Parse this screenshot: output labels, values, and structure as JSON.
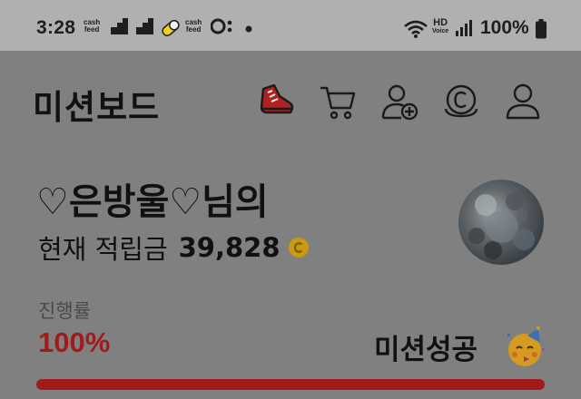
{
  "status_bar": {
    "time": "3:28",
    "notification_labels": [
      "cash\nfeed",
      "cash\nfeed"
    ],
    "network_hd": "HD",
    "network_voice": "Voice",
    "battery": "100%"
  },
  "header": {
    "title": "미션보드",
    "icons": [
      "sneaker-icon",
      "cart-icon",
      "add-friend-icon",
      "coin-history-icon",
      "profile-icon"
    ]
  },
  "user": {
    "name": "♡은방울♡님의",
    "points_label": "현재 적립금",
    "points_value": "39,828"
  },
  "progress": {
    "label": "진행률",
    "value": "100%",
    "percent": 100,
    "status": "미션성공"
  },
  "colors": {
    "accent_red": "#a21a1a",
    "coin_gold": "#c89b10",
    "overlay_gray": "#808080",
    "status_bar_gray": "#b0b0b0"
  }
}
